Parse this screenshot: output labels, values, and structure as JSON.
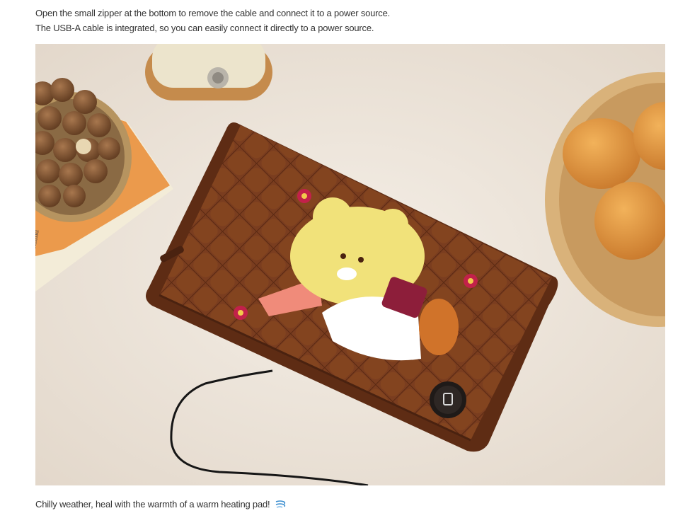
{
  "intro": {
    "line1": "Open the small zipper at the bottom to remove the cable and connect it to a power source.",
    "line2": "The USB-A cable is integrated, so you can easily connect it directly to a power source."
  },
  "photo": {
    "book_text": "commu",
    "icons": [
      "macadamia-bowl",
      "lamp-base",
      "book",
      "potato-basket",
      "heating-pad",
      "bear-patch",
      "flower-patch",
      "power-button",
      "usb-cable"
    ]
  },
  "caption": {
    "text": "Chilly weather, heal with the warmth of a warm heating pad!",
    "icon": "wind-icon"
  },
  "colors": {
    "rug": "#efe8df",
    "pad": "#7a3d1f",
    "pad_dark": "#5e2c14",
    "bear": "#f1e27a",
    "flower": "#c2214a"
  }
}
